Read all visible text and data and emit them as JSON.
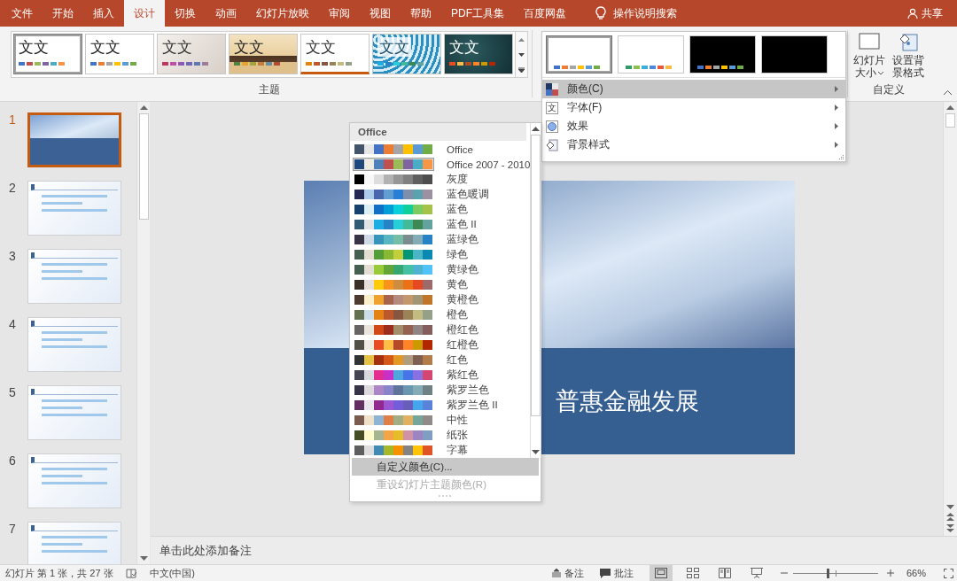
{
  "ribbon_tabs": [
    {
      "label": "文件",
      "selected": false
    },
    {
      "label": "开始",
      "selected": false
    },
    {
      "label": "插入",
      "selected": false
    },
    {
      "label": "设计",
      "selected": true
    },
    {
      "label": "切换",
      "selected": false
    },
    {
      "label": "动画",
      "selected": false
    },
    {
      "label": "幻灯片放映",
      "selected": false
    },
    {
      "label": "审阅",
      "selected": false
    },
    {
      "label": "视图",
      "selected": false
    },
    {
      "label": "帮助",
      "selected": false
    },
    {
      "label": "PDF工具集",
      "selected": false
    },
    {
      "label": "百度网盘",
      "selected": false
    }
  ],
  "search_hint": "操作说明搜索",
  "share_label": "共享",
  "theme_group_label": "主题",
  "themes": [
    {
      "sample": "文文",
      "kind": "plain",
      "selected": true,
      "swatches": [
        {
          "color": "#4472c4"
        },
        {
          "color": "#c0504d"
        },
        {
          "color": "#9bbb59"
        },
        {
          "color": "#8064a2"
        },
        {
          "color": "#4bacc6"
        },
        {
          "color": "#f79646"
        }
      ]
    },
    {
      "sample": "文文",
      "kind": "plain",
      "selected": false,
      "swatches": [
        {
          "color": "#4472c4"
        },
        {
          "color": "#ed7d31"
        },
        {
          "color": "#a5a5a5"
        },
        {
          "color": "#ffc000"
        },
        {
          "color": "#5b9bd5"
        },
        {
          "color": "#70ad47"
        }
      ]
    },
    {
      "sample": "文文",
      "kind": "texture",
      "selected": false,
      "swatches": [
        {
          "color": "#b83b5e"
        },
        {
          "color": "#c04fa8"
        },
        {
          "color": "#8e58b6"
        },
        {
          "color": "#6e68b8"
        },
        {
          "color": "#5e79b4"
        },
        {
          "color": "#9b7b9e"
        }
      ]
    },
    {
      "sample": "文文",
      "kind": "wood",
      "selected": false,
      "swatches": [
        {
          "color": "#4e8542"
        },
        {
          "color": "#e3a32c"
        },
        {
          "color": "#a3a43a"
        },
        {
          "color": "#c07d3e"
        },
        {
          "color": "#6c8d9e"
        },
        {
          "color": "#b04c2f"
        }
      ]
    },
    {
      "sample": "文文",
      "kind": "stripe",
      "selected": false,
      "swatches": [
        {
          "color": "#e48312"
        },
        {
          "color": "#bd582c"
        },
        {
          "color": "#865640"
        },
        {
          "color": "#9b8357"
        },
        {
          "color": "#c2bc80"
        },
        {
          "color": "#94a088"
        }
      ]
    },
    {
      "sample": "文文",
      "kind": "pattern",
      "selected": false,
      "swatches": [
        {
          "color": "#1cade4"
        },
        {
          "color": "#2683c6"
        },
        {
          "color": "#27ced7"
        },
        {
          "color": "#42ba97"
        },
        {
          "color": "#3e8853"
        },
        {
          "color": "#62a39f"
        }
      ]
    },
    {
      "sample": "文文",
      "kind": "dark",
      "selected": false,
      "swatches": [
        {
          "color": "#e84c22"
        },
        {
          "color": "#ffbd47"
        },
        {
          "color": "#b64926"
        },
        {
          "color": "#ff8427"
        },
        {
          "color": "#cc9900"
        },
        {
          "color": "#b22600"
        }
      ]
    }
  ],
  "variants": [
    {
      "dark": false,
      "selected": true,
      "swatches": [
        {
          "color": "#4472c4"
        },
        {
          "color": "#ed7d31"
        },
        {
          "color": "#a5a5a5"
        },
        {
          "color": "#ffc000"
        },
        {
          "color": "#5b9bd5"
        },
        {
          "color": "#70ad47"
        }
      ]
    },
    {
      "dark": false,
      "selected": false,
      "swatches": [
        {
          "color": "#2e9c6b"
        },
        {
          "color": "#8cc152"
        },
        {
          "color": "#3bafda"
        },
        {
          "color": "#4a89dc"
        },
        {
          "color": "#e9573f"
        },
        {
          "color": "#f6bb42"
        }
      ]
    },
    {
      "dark": true,
      "selected": false,
      "swatches": [
        {
          "color": "#4472c4"
        },
        {
          "color": "#ed7d31"
        },
        {
          "color": "#a5a5a5"
        },
        {
          "color": "#ffc000"
        },
        {
          "color": "#5b9bd5"
        },
        {
          "color": "#70ad47"
        }
      ]
    },
    {
      "dark": true,
      "selected": false
    }
  ],
  "customize_menu": [
    {
      "label": "颜色(C)",
      "kind": "colors",
      "selected": true
    },
    {
      "label": "字体(F)",
      "kind": "fonts",
      "glyph": "文",
      "selected": false
    },
    {
      "label": "效果",
      "kind": "effects",
      "selected": false
    },
    {
      "label": "背景样式",
      "kind": "background",
      "selected": false
    }
  ],
  "custom_group": {
    "label": "自定义",
    "buttons": [
      {
        "label": "幻灯片大小",
        "kind": "slide-size"
      },
      {
        "label": "设置背景格式",
        "kind": "background"
      }
    ]
  },
  "color_dropdown": {
    "header": "Office",
    "schemes": [
      {
        "name": "Office",
        "selected": false,
        "swatches": [
          {
            "color": "#44546a"
          },
          {
            "color": "#e7e6e6"
          },
          {
            "color": "#4472c4"
          },
          {
            "color": "#ed7d31"
          },
          {
            "color": "#a5a5a5"
          },
          {
            "color": "#ffc000"
          },
          {
            "color": "#5b9bd5"
          },
          {
            "color": "#70ad47"
          }
        ]
      },
      {
        "name": "Office 2007 - 2010",
        "selected": true,
        "swatches": [
          {
            "color": "#1f497d"
          },
          {
            "color": "#eeece1"
          },
          {
            "color": "#4f81bd"
          },
          {
            "color": "#c0504d"
          },
          {
            "color": "#9bbb59"
          },
          {
            "color": "#8064a2"
          },
          {
            "color": "#4bacc6"
          },
          {
            "color": "#f79646"
          }
        ]
      },
      {
        "name": "灰度",
        "selected": false,
        "swatches": [
          {
            "color": "#000000"
          },
          {
            "color": "#f8f8f8"
          },
          {
            "color": "#dddddd"
          },
          {
            "color": "#b2b2b2"
          },
          {
            "color": "#969696"
          },
          {
            "color": "#808080"
          },
          {
            "color": "#5f5f5f"
          },
          {
            "color": "#4d4d4d"
          }
        ]
      },
      {
        "name": "蓝色暖调",
        "selected": false,
        "swatches": [
          {
            "color": "#242852"
          },
          {
            "color": "#acccea"
          },
          {
            "color": "#4a66ac"
          },
          {
            "color": "#629dd1"
          },
          {
            "color": "#297fd5"
          },
          {
            "color": "#7f8fa9"
          },
          {
            "color": "#5aa2ae"
          },
          {
            "color": "#9d90a0"
          }
        ]
      },
      {
        "name": "蓝色",
        "selected": false,
        "swatches": [
          {
            "color": "#17406d"
          },
          {
            "color": "#dbeff9"
          },
          {
            "color": "#0f6fc6"
          },
          {
            "color": "#009dd9"
          },
          {
            "color": "#0bd0d9"
          },
          {
            "color": "#10cf9b"
          },
          {
            "color": "#7cca62"
          },
          {
            "color": "#a5c249"
          }
        ]
      },
      {
        "name": "蓝色 II",
        "selected": false,
        "swatches": [
          {
            "color": "#335b74"
          },
          {
            "color": "#dfe3e5"
          },
          {
            "color": "#1cade4"
          },
          {
            "color": "#2683c6"
          },
          {
            "color": "#27ced7"
          },
          {
            "color": "#42ba97"
          },
          {
            "color": "#3e8853"
          },
          {
            "color": "#62a39f"
          }
        ]
      },
      {
        "name": "蓝绿色",
        "selected": false,
        "swatches": [
          {
            "color": "#373545"
          },
          {
            "color": "#cedbe6"
          },
          {
            "color": "#3494ba"
          },
          {
            "color": "#58b6c0"
          },
          {
            "color": "#75bda7"
          },
          {
            "color": "#7a8c8e"
          },
          {
            "color": "#84acb6"
          },
          {
            "color": "#2683c6"
          }
        ]
      },
      {
        "name": "绿色",
        "selected": false,
        "swatches": [
          {
            "color": "#455f51"
          },
          {
            "color": "#e3ded1"
          },
          {
            "color": "#549e39"
          },
          {
            "color": "#8ab833"
          },
          {
            "color": "#c0cf3a"
          },
          {
            "color": "#029676"
          },
          {
            "color": "#4ab5c4"
          },
          {
            "color": "#0989b1"
          }
        ]
      },
      {
        "name": "黄绿色",
        "selected": false,
        "swatches": [
          {
            "color": "#455f51"
          },
          {
            "color": "#e3ded1"
          },
          {
            "color": "#99cb38"
          },
          {
            "color": "#63a537"
          },
          {
            "color": "#37a76f"
          },
          {
            "color": "#44c1a3"
          },
          {
            "color": "#4eb3cf"
          },
          {
            "color": "#51c3f9"
          }
        ]
      },
      {
        "name": "黄色",
        "selected": false,
        "swatches": [
          {
            "color": "#39302a"
          },
          {
            "color": "#e5dedb"
          },
          {
            "color": "#ffca08"
          },
          {
            "color": "#f8931d"
          },
          {
            "color": "#ce8d3e"
          },
          {
            "color": "#ec7016"
          },
          {
            "color": "#e64823"
          },
          {
            "color": "#9c6a6a"
          }
        ]
      },
      {
        "name": "黄橙色",
        "selected": false,
        "swatches": [
          {
            "color": "#4e3b30"
          },
          {
            "color": "#fbeec9"
          },
          {
            "color": "#f0a22e"
          },
          {
            "color": "#a5644e"
          },
          {
            "color": "#b58b80"
          },
          {
            "color": "#c3986d"
          },
          {
            "color": "#a19574"
          },
          {
            "color": "#c17529"
          }
        ]
      },
      {
        "name": "橙色",
        "selected": false,
        "swatches": [
          {
            "color": "#637052"
          },
          {
            "color": "#ccddea"
          },
          {
            "color": "#e48312"
          },
          {
            "color": "#bd582c"
          },
          {
            "color": "#865640"
          },
          {
            "color": "#9b8357"
          },
          {
            "color": "#c2bc80"
          },
          {
            "color": "#94a088"
          }
        ]
      },
      {
        "name": "橙红色",
        "selected": false,
        "swatches": [
          {
            "color": "#696464"
          },
          {
            "color": "#e9e5dc"
          },
          {
            "color": "#d34817"
          },
          {
            "color": "#9b2d1f"
          },
          {
            "color": "#a28e6a"
          },
          {
            "color": "#956251"
          },
          {
            "color": "#918485"
          },
          {
            "color": "#855d5d"
          }
        ]
      },
      {
        "name": "红橙色",
        "selected": false,
        "swatches": [
          {
            "color": "#505046"
          },
          {
            "color": "#eeece1"
          },
          {
            "color": "#e84c22"
          },
          {
            "color": "#ffbd47"
          },
          {
            "color": "#b64926"
          },
          {
            "color": "#ff8427"
          },
          {
            "color": "#cc9900"
          },
          {
            "color": "#b22600"
          }
        ]
      },
      {
        "name": "红色",
        "selected": false,
        "swatches": [
          {
            "color": "#323232"
          },
          {
            "color": "#e5c243"
          },
          {
            "color": "#a5300f"
          },
          {
            "color": "#d55816"
          },
          {
            "color": "#e19825"
          },
          {
            "color": "#b19c7d"
          },
          {
            "color": "#7f5f52"
          },
          {
            "color": "#b27d49"
          }
        ]
      },
      {
        "name": "紫红色",
        "selected": false,
        "swatches": [
          {
            "color": "#454551"
          },
          {
            "color": "#d8d9dc"
          },
          {
            "color": "#e32d91"
          },
          {
            "color": "#c830cc"
          },
          {
            "color": "#4ea6dc"
          },
          {
            "color": "#4775e7"
          },
          {
            "color": "#8971e1"
          },
          {
            "color": "#d54773"
          }
        ]
      },
      {
        "name": "紫罗兰色",
        "selected": false,
        "swatches": [
          {
            "color": "#373545"
          },
          {
            "color": "#dcd8dc"
          },
          {
            "color": "#ad84c6"
          },
          {
            "color": "#8784c7"
          },
          {
            "color": "#5d739a"
          },
          {
            "color": "#6997af"
          },
          {
            "color": "#84acb6"
          },
          {
            "color": "#6f8183"
          }
        ]
      },
      {
        "name": "紫罗兰色 II",
        "selected": false,
        "swatches": [
          {
            "color": "#632e62"
          },
          {
            "color": "#eae5eb"
          },
          {
            "color": "#92278f"
          },
          {
            "color": "#9b57d3"
          },
          {
            "color": "#755dd9"
          },
          {
            "color": "#665eb8"
          },
          {
            "color": "#45a5ed"
          },
          {
            "color": "#5982db"
          }
        ]
      },
      {
        "name": "中性",
        "selected": false,
        "swatches": [
          {
            "color": "#7b5a4f"
          },
          {
            "color": "#eee0c9"
          },
          {
            "color": "#8eb4d5"
          },
          {
            "color": "#e07f45"
          },
          {
            "color": "#a1ae85"
          },
          {
            "color": "#dfb160"
          },
          {
            "color": "#76a59a"
          },
          {
            "color": "#908a88"
          }
        ]
      },
      {
        "name": "纸张",
        "selected": false,
        "swatches": [
          {
            "color": "#444d26"
          },
          {
            "color": "#fefac9"
          },
          {
            "color": "#a5b592"
          },
          {
            "color": "#f3a447"
          },
          {
            "color": "#e7bc29"
          },
          {
            "color": "#d092a7"
          },
          {
            "color": "#9c85c0"
          },
          {
            "color": "#809ec2"
          }
        ]
      },
      {
        "name": "字幕",
        "selected": false,
        "swatches": [
          {
            "color": "#5e5e5e"
          },
          {
            "color": "#dddddd"
          },
          {
            "color": "#418ab3"
          },
          {
            "color": "#a6b727"
          },
          {
            "color": "#f69200"
          },
          {
            "color": "#838383"
          },
          {
            "color": "#fec306"
          },
          {
            "color": "#df5327"
          }
        ]
      }
    ],
    "actions": [
      {
        "label": "自定义颜色(C)...",
        "selected": true,
        "disabled": false
      },
      {
        "label": "重设幻灯片主题颜色(R)",
        "selected": false,
        "disabled": true
      }
    ]
  },
  "slides": [
    {
      "number": "1",
      "kind": "title",
      "selected": true
    },
    {
      "number": "2",
      "kind": "content",
      "selected": false
    },
    {
      "number": "3",
      "kind": "content",
      "selected": false
    },
    {
      "number": "4",
      "kind": "content",
      "selected": false
    },
    {
      "number": "5",
      "kind": "content",
      "selected": false
    },
    {
      "number": "6",
      "kind": "content",
      "selected": false
    },
    {
      "number": "7",
      "kind": "content",
      "selected": false
    }
  ],
  "slide": {
    "title": "普惠金融发展"
  },
  "notes_placeholder": "单击此处添加备注",
  "status": {
    "slide_info": "幻灯片 第 1 张，共 27 张",
    "language": "中文(中国)",
    "notes_label": "备注",
    "comments_label": "批注",
    "views": [
      {
        "kind": "normal",
        "selected": true
      },
      {
        "kind": "sorter",
        "selected": false
      },
      {
        "kind": "reading",
        "selected": false
      },
      {
        "kind": "show",
        "selected": false
      }
    ],
    "zoom": {
      "level": 0.4,
      "reading": "66%"
    }
  }
}
